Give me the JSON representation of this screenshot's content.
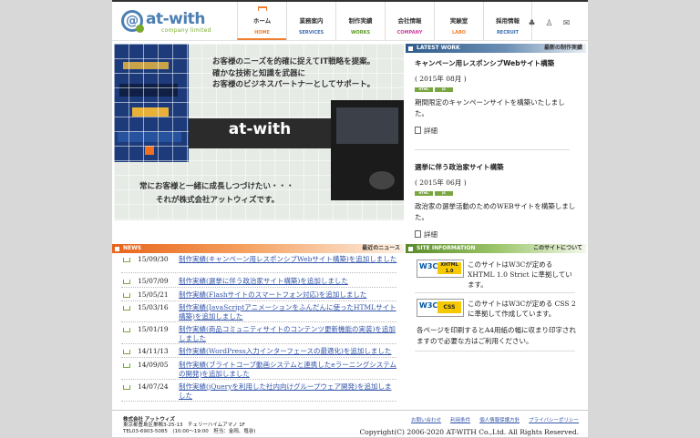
{
  "logo": {
    "name": "at-with",
    "sub": "company limited"
  },
  "nav": [
    {
      "jp": "ホーム",
      "en": "HOME",
      "color": "#f08030"
    },
    {
      "jp": "業務案内",
      "en": "SERVICES",
      "color": "#3a6fb0"
    },
    {
      "jp": "制作実績",
      "en": "WORKS",
      "color": "#5a9a20"
    },
    {
      "jp": "会社情報",
      "en": "COMPANY",
      "color": "#d040a0"
    },
    {
      "jp": "実験室",
      "en": "LABO",
      "color": "#f08030"
    },
    {
      "jp": "採用情報",
      "en": "RECRUIT",
      "color": "#3a6fb0"
    }
  ],
  "hero": {
    "copy1": [
      "お客様のニーズを的確に捉えてIT戦略を提案。",
      "確かな技術と知識を武器に",
      "お客様のビジネスパートナーとしてサポート。"
    ],
    "brand": "at-with",
    "copy2": [
      "常にお客様と一緒に成長しつづけたい・・・",
      "それが株式会社アットウィズです。"
    ]
  },
  "latest": {
    "title": "LATEST WORK",
    "sub": "最新の制作実績",
    "items": [
      {
        "title": "キャンペーン用レスポンシブWebサイト構築",
        "date": "( 2015年 08月 )",
        "tags": [
          "HTML",
          "JS"
        ],
        "desc": "期間限定のキャンペーンサイトを構築いたしました。",
        "more": "詳細"
      },
      {
        "title": "選挙に伴う政治家サイト構築",
        "date": "( 2015年 06月 )",
        "tags": [
          "HTML",
          "JS"
        ],
        "desc": "政治家の選挙活動のためのWEBサイトを構築しました。",
        "more": "詳細"
      }
    ]
  },
  "news": {
    "title": "NEWS",
    "sub": "最近のニュース",
    "items": [
      {
        "date": "15/09/30",
        "text": "制作実績(キャンペーン用レスポンシブWebサイト構築)を追加しました"
      },
      {
        "date": "15/07/09",
        "text": "制作実績(選挙に伴う政治家サイト構築)を追加しました"
      },
      {
        "date": "15/05/21",
        "text": "制作実績(Flashサイトのスマートフォン対応)を追加しました"
      },
      {
        "date": "15/03/16",
        "text": "制作実績(JavaScriptアニメーションをふんだんに使ったHTMLサイト構築)を追加しました"
      },
      {
        "date": "15/01/19",
        "text": "制作実績(商品コミュニティサイトのコンテンツ更新機能の実装)を追加しました"
      },
      {
        "date": "14/11/13",
        "text": "制作実績(WordPress入力インターフェースの最適化)を追加しました"
      },
      {
        "date": "14/09/05",
        "text": "制作実績(ブライトコーブ動画システムと連携したeラーニングシステムの開発)を追加しました"
      },
      {
        "date": "14/07/24",
        "text": "制作実績(jQueryを利用した社内向けグループウェア開発)を追加しました"
      }
    ]
  },
  "site": {
    "title": "SITE INFORMATION",
    "sub": "このサイトについて",
    "xhtml_badge": "XHTML 1.0",
    "css_badge": "CSS",
    "xhtml_text": "このサイトはW3Cが定める XHTML 1.0 Strict に準拠しています。",
    "css_text": "このサイトはW3Cが定める CSS 2 に準拠して作成しています。",
    "note": "各ページを印刷するとA4用紙の幅に収まり印字されますので必要な方はご利用ください。"
  },
  "footer": {
    "company": "株式会社 アットウィズ",
    "address": "東京都豊島区巣鴨3-25-13　チェリーハイムアマノ 1F",
    "tel": "TEL03-6903-5085　(10:00〜19:00　担当：金岡、塩谷)",
    "links": [
      "お問い合わせ",
      "利用条件",
      "個人情報保護方針",
      "プライバシーポリシー"
    ],
    "copyright": "Copyright(C) 2006-2020 AT-WITH Co.,Ltd. All Rights Reserved."
  }
}
